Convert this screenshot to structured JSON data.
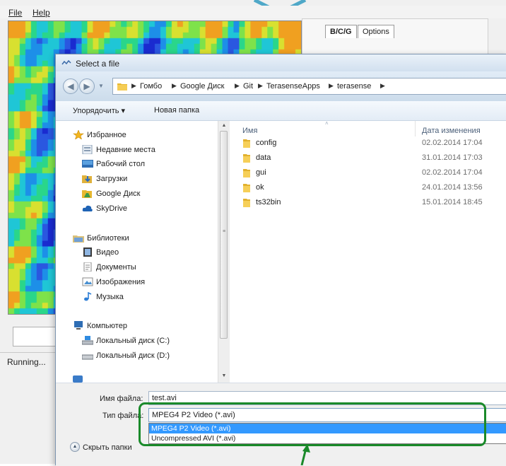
{
  "app": {
    "menu": [
      "File",
      "Help"
    ],
    "tabs": [
      "B/C/G",
      "Options"
    ],
    "status": "Running..."
  },
  "dialog": {
    "title": "Select a file",
    "breadcrumbs": [
      "Гомбо",
      "Google Диск",
      "Git",
      "TerasenseApps",
      "terasense"
    ],
    "toolbar": {
      "organize": "Упорядочить ▾",
      "new_folder": "Новая папка"
    },
    "nav": {
      "favorites": "Избранное",
      "favorites_items": [
        "Недавние места",
        "Рабочий стол",
        "Загрузки",
        "Google Диск",
        "SkyDrive"
      ],
      "libraries": "Библиотеки",
      "libraries_items": [
        "Видео",
        "Документы",
        "Изображения",
        "Музыка"
      ],
      "computer": "Компьютер",
      "computer_items": [
        "Локальный диск (C:)",
        "Локальный диск (D:)"
      ]
    },
    "columns": {
      "name": "Имя",
      "date": "Дата изменения"
    },
    "files": [
      {
        "name": "config",
        "date": "02.02.2014 17:04"
      },
      {
        "name": "data",
        "date": "31.01.2014 17:03"
      },
      {
        "name": "gui",
        "date": "02.02.2014 17:04"
      },
      {
        "name": "ok",
        "date": "24.01.2014 13:56"
      },
      {
        "name": "ts32bin",
        "date": "15.01.2014 18:45"
      }
    ],
    "filename_label": "Имя файла:",
    "filename_value": "test.avi",
    "filetype_label": "Тип файла:",
    "filetype_selected": "MPEG4 P2 Video (*.avi)",
    "filetype_options": [
      "MPEG4 P2 Video (*.avi)",
      "Uncompressed AVI (*.avi)"
    ],
    "hide_folders": "Скрыть папки"
  },
  "colors": {
    "highlight": "#1a8a2a",
    "selection": "#3399ff",
    "dialog_frame": "#dce7f2",
    "accent_v": "#4fa8c8"
  }
}
